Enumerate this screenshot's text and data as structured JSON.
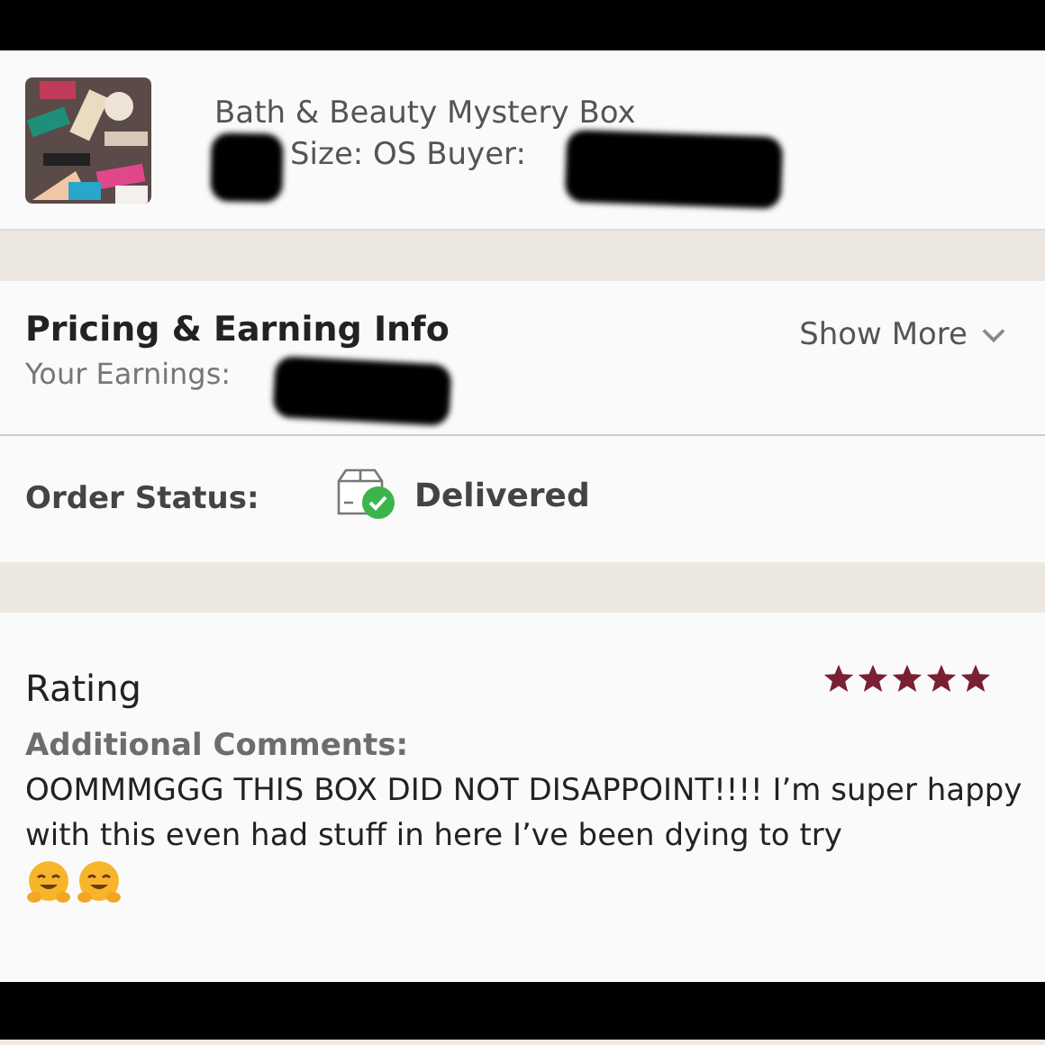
{
  "item": {
    "title": "Bath & Beauty Mystery Box",
    "details": "Size: OS  Buyer:"
  },
  "pricing": {
    "title": "Pricing & Earning Info",
    "earnings_label": "Your Earnings:",
    "show_more": "Show More"
  },
  "order_status": {
    "label": "Order Status:",
    "value": "Delivered"
  },
  "rating": {
    "title": "Rating",
    "stars": 5,
    "comments_label": "Additional Comments:",
    "comment": "OOMMMGGG THIS BOX DID NOT DISAPPOINT!!!! I’m super happy with this even had stuff in here I’ve been dying to try",
    "emojis": [
      {
        "kind": "hugging-face"
      },
      {
        "kind": "hugging-face"
      }
    ]
  }
}
